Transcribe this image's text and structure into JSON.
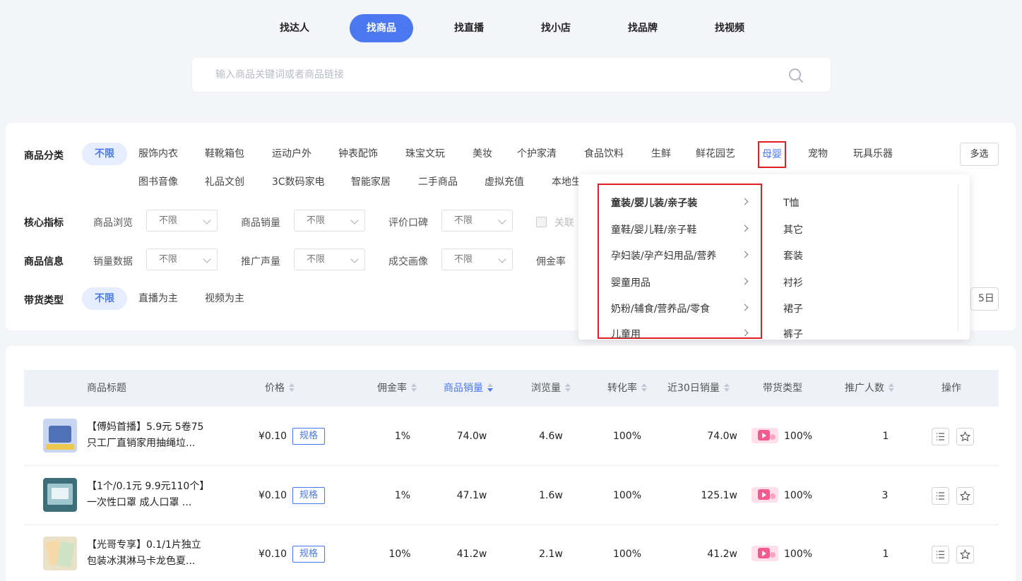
{
  "tabs": [
    "找达人",
    "找商品",
    "找直播",
    "找小店",
    "找品牌",
    "找视频"
  ],
  "active_tab": "找商品",
  "search": {
    "placeholder": "输入商品关键词或者商品链接",
    "icon": "search-icon"
  },
  "filters": {
    "category_label": "商品分类",
    "unlimited": "不限",
    "categories_row1": [
      "服饰内衣",
      "鞋靴箱包",
      "运动户外",
      "钟表配饰",
      "珠宝文玩",
      "美妆",
      "个护家清",
      "食品饮料",
      "生鲜",
      "鲜花园艺",
      "母婴",
      "宠物",
      "玩具乐器"
    ],
    "categories_row2": [
      "图书音像",
      "礼品文创",
      "3C数码家电",
      "智能家居",
      "二手商品",
      "虚拟充值",
      "本地生"
    ],
    "multi_select": "多选",
    "core_label": "核心指标",
    "core_fields": [
      {
        "label": "商品浏览",
        "value": "不限"
      },
      {
        "label": "商品销量",
        "value": "不限"
      },
      {
        "label": "评价口碑",
        "value": "不限"
      }
    ],
    "core_checkbox_label": "关联",
    "info_label": "商品信息",
    "info_fields": [
      {
        "label": "销量数据",
        "value": "不限"
      },
      {
        "label": "推广声量",
        "value": "不限"
      },
      {
        "label": "成交画像",
        "value": "不限"
      }
    ],
    "info_extra_label": "佣金率",
    "delivery_label": "带货类型",
    "delivery_options": [
      "不限",
      "直播为主",
      "视频为主"
    ],
    "date_fragment": "5日"
  },
  "popup": {
    "subcategories": [
      "童装/婴儿装/亲子装",
      "童鞋/婴儿鞋/亲子鞋",
      "孕妇装/孕产妇用品/营养",
      "婴童用品",
      "奶粉/辅食/营养品/零食",
      "儿童用"
    ],
    "leaves": [
      "T恤",
      "其它",
      "套装",
      "衬衫",
      "裙子",
      "裤子"
    ]
  },
  "table": {
    "headers": {
      "title": "商品标题",
      "price": "价格",
      "commission": "佣金率",
      "sales": "商品销量",
      "views": "浏览量",
      "conversion": "转化率",
      "sales30": "近30日销量",
      "type": "带货类型",
      "promoters": "推广人数",
      "actions": "操作"
    },
    "spec_label": "规格",
    "rows": [
      {
        "title1": "【傅妈首播】5.9元 5卷75",
        "title2": "只工厂直销家用抽绳垃...",
        "price": "¥0.10",
        "commission": "1%",
        "sales": "74.0w",
        "views": "4.6w",
        "conversion": "100%",
        "sales30": "74.0w",
        "live_ratio": "100%",
        "promoters": "1"
      },
      {
        "title1": "【1个/0.1元 9.9元110个】",
        "title2": "一次性口罩 成人口罩 ...",
        "price": "¥0.10",
        "commission": "1%",
        "sales": "47.1w",
        "views": "1.6w",
        "conversion": "100%",
        "sales30": "125.1w",
        "live_ratio": "100%",
        "promoters": "3"
      },
      {
        "title1": "【光哥专享】0.1/1片独立",
        "title2": "包装冰淇淋马卡龙色夏...",
        "price": "¥0.10",
        "commission": "10%",
        "sales": "41.2w",
        "views": "2.1w",
        "conversion": "100%",
        "sales30": "41.2w",
        "live_ratio": "100%",
        "promoters": "1"
      }
    ]
  },
  "colors": {
    "accent": "#4a78f0",
    "highlight_box": "#e02020",
    "background": "#f4f5f9"
  }
}
